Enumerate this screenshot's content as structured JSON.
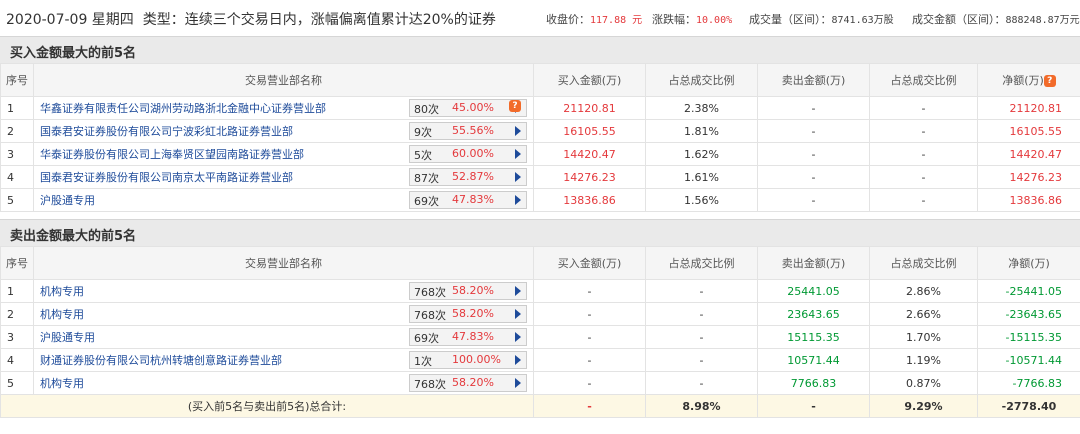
{
  "header": {
    "date": "2020-07-09 星期四",
    "type_label": "类型：连续三个交易日内，涨幅偏离值累计达20%的证券",
    "close_label": "收盘价：",
    "close_value": "117.88 元",
    "change_label": "涨跌幅：",
    "change_value": "10.00%",
    "volume_label": "成交量（区间）：",
    "volume_value": "8741.63万股",
    "amount_label": "成交金额（区间）：",
    "amount_value": "888248.87万元"
  },
  "buy_section": {
    "title": "买入金额最大的前5名",
    "columns": [
      "序号",
      "交易营业部名称",
      "买入金额(万)",
      "占总成交比例",
      "卖出金额(万)",
      "占总成交比例",
      "净额(万)"
    ],
    "rows": [
      {
        "idx": "1",
        "name": "华鑫证券有限责任公司湖州劳动路浙北金融中心证券营业部",
        "count": "80次",
        "pct": "45.00%",
        "buy": "21120.81",
        "buy_pct": "2.38%",
        "sell": "-",
        "sell_pct": "-",
        "net": "21120.81"
      },
      {
        "idx": "2",
        "name": "国泰君安证券股份有限公司宁波彩虹北路证券营业部",
        "count": "9次",
        "pct": "55.56%",
        "buy": "16105.55",
        "buy_pct": "1.81%",
        "sell": "-",
        "sell_pct": "-",
        "net": "16105.55"
      },
      {
        "idx": "3",
        "name": "华泰证券股份有限公司上海奉贤区望园南路证券营业部",
        "count": "5次",
        "pct": "60.00%",
        "buy": "14420.47",
        "buy_pct": "1.62%",
        "sell": "-",
        "sell_pct": "-",
        "net": "14420.47"
      },
      {
        "idx": "4",
        "name": "国泰君安证券股份有限公司南京太平南路证券营业部",
        "count": "87次",
        "pct": "52.87%",
        "buy": "14276.23",
        "buy_pct": "1.61%",
        "sell": "-",
        "sell_pct": "-",
        "net": "14276.23"
      },
      {
        "idx": "5",
        "name": "沪股通专用",
        "count": "69次",
        "pct": "47.83%",
        "buy": "13836.86",
        "buy_pct": "1.56%",
        "sell": "-",
        "sell_pct": "-",
        "net": "13836.86"
      }
    ]
  },
  "sell_section": {
    "title": "卖出金额最大的前5名",
    "columns": [
      "序号",
      "交易营业部名称",
      "买入金额(万)",
      "占总成交比例",
      "卖出金额(万)",
      "占总成交比例",
      "净额(万)"
    ],
    "rows": [
      {
        "idx": "1",
        "name": "机构专用",
        "count": "768次",
        "pct": "58.20%",
        "buy": "-",
        "buy_pct": "-",
        "sell": "25441.05",
        "sell_pct": "2.86%",
        "net": "-25441.05"
      },
      {
        "idx": "2",
        "name": "机构专用",
        "count": "768次",
        "pct": "58.20%",
        "buy": "-",
        "buy_pct": "-",
        "sell": "23643.65",
        "sell_pct": "2.66%",
        "net": "-23643.65"
      },
      {
        "idx": "3",
        "name": "沪股通专用",
        "count": "69次",
        "pct": "47.83%",
        "buy": "-",
        "buy_pct": "-",
        "sell": "15115.35",
        "sell_pct": "1.70%",
        "net": "-15115.35"
      },
      {
        "idx": "4",
        "name": "财通证券股份有限公司杭州转塘创意路证券营业部",
        "count": "1次",
        "pct": "100.00%",
        "buy": "-",
        "buy_pct": "-",
        "sell": "10571.44",
        "sell_pct": "1.19%",
        "net": "-10571.44"
      },
      {
        "idx": "5",
        "name": "机构专用",
        "count": "768次",
        "pct": "58.20%",
        "buy": "-",
        "buy_pct": "-",
        "sell": "7766.83",
        "sell_pct": "0.87%",
        "net": "-7766.83"
      }
    ],
    "total": {
      "label": "(买入前5名与卖出前5名)总合计:",
      "buy": "-",
      "buy_pct": "8.98%",
      "sell": "-",
      "sell_pct": "9.29%",
      "net": "-2778.40"
    }
  },
  "icons": {
    "question": "question-icon",
    "arrow": "play-arrow-icon"
  },
  "colors": {
    "up": "#e4393c",
    "down": "#009933",
    "link": "#1e4b9a"
  }
}
